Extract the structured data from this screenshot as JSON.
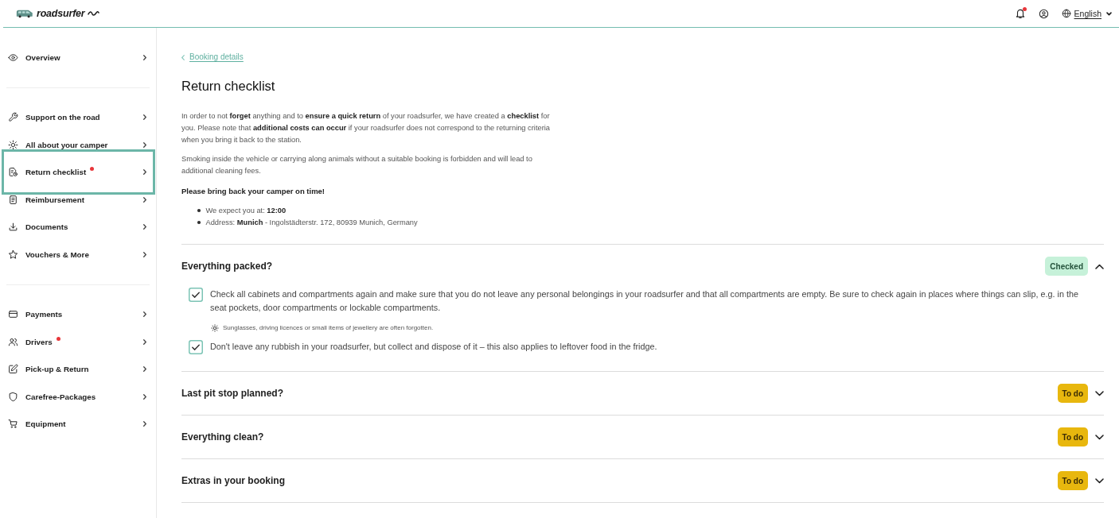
{
  "header": {
    "logo": "roadsurfer",
    "notifications_alert": true,
    "language": "English"
  },
  "sidebar": {
    "groups": [
      {
        "items": [
          {
            "label": "Overview",
            "selected": false,
            "alert": false
          }
        ]
      },
      {
        "items": [
          {
            "label": "Support on the road",
            "selected": false,
            "alert": false
          },
          {
            "label": "All about your camper",
            "selected": false,
            "alert": false
          },
          {
            "label": "Return checklist",
            "selected": true,
            "alert": true
          },
          {
            "label": "Reimbursement",
            "selected": false,
            "alert": false
          },
          {
            "label": "Documents",
            "selected": false,
            "alert": false
          },
          {
            "label": "Vouchers & More",
            "selected": false,
            "alert": false
          }
        ]
      },
      {
        "items": [
          {
            "label": "Payments",
            "selected": false,
            "alert": false
          },
          {
            "label": "Drivers",
            "selected": false,
            "alert": true
          },
          {
            "label": "Pick-up & Return",
            "selected": false,
            "alert": false
          },
          {
            "label": "Carefree-Packages",
            "selected": false,
            "alert": false
          },
          {
            "label": "Equipment",
            "selected": false,
            "alert": false
          }
        ]
      }
    ]
  },
  "page": {
    "back_link": "Booking details",
    "title": "Return checklist",
    "intro": [
      "In order to not **forget** anything and to **ensure a quick return** of your roadsurfer, we have created a **checklist** for you. Please note that **additional costs can occur** if your roadsurfer does not correspond to the returning criteria when you bring it back to the station.",
      "Smoking inside the vehicle or carrying along animals without a suitable booking is forbidden and will lead to additional cleaning fees."
    ],
    "notice": "Please bring back your camper on time!",
    "details": [
      "We expect you at: **12:00**",
      "Address: **Munich** - Ingolstädterstr. 172, 80939 Munich, Germany"
    ]
  },
  "sections": [
    {
      "title": "Everything packed?",
      "status": "Checked",
      "done": true,
      "expanded": true,
      "items": [
        {
          "kind": "checkbox",
          "text": "Check all cabinets and compartments again and make sure that you do not leave any personal belongings in your roadsurfer and that all compartments are empty. Be sure to check again in places where things can slip, e.g. in the seat pockets, door compartments or lockable compartments.",
          "checked": true
        },
        {
          "kind": "tip",
          "text": "Sunglasses, driving licences or small items of jewellery are often forgotten."
        },
        {
          "kind": "checkbox",
          "text": "Don't leave any rubbish in your roadsurfer, but collect and dispose of it – this also applies to leftover food in the fridge.",
          "checked": true
        }
      ]
    },
    {
      "title": "Last pit stop planned?",
      "status": "To do",
      "done": false,
      "expanded": false
    },
    {
      "title": "Everything clean?",
      "status": "To do",
      "done": false,
      "expanded": false
    },
    {
      "title": "Extras in your booking",
      "status": "To do",
      "done": false,
      "expanded": false
    }
  ]
}
